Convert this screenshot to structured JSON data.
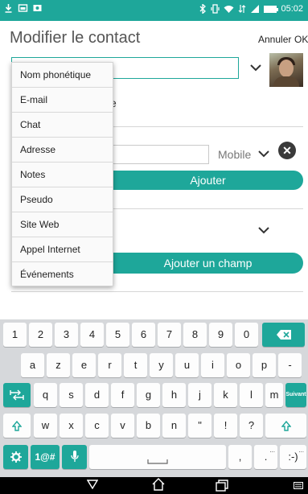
{
  "header": {
    "title": "Modifier le contact",
    "cancel_label": "Annuler",
    "ok_label": "OK"
  },
  "status_bar": {
    "time": "05:02"
  },
  "form": {
    "partial_label_tail": "e",
    "phone_type": "Mobile",
    "add_label": "Ajouter",
    "add_field_label": "Ajouter un champ"
  },
  "dropdown": {
    "items": [
      "Nom phonétique",
      "E-mail",
      "Chat",
      "Adresse",
      "Notes",
      "Pseudo",
      "Site Web",
      "Appel Internet",
      "Événements"
    ]
  },
  "keyboard": {
    "row_numbers": [
      "1",
      "2",
      "3",
      "4",
      "5",
      "6",
      "7",
      "8",
      "9",
      "0"
    ],
    "row_azerty": [
      "a",
      "z",
      "e",
      "r",
      "t",
      "y",
      "u",
      "i",
      "o",
      "p",
      "-"
    ],
    "row_middle": [
      "q",
      "s",
      "d",
      "f",
      "g",
      "h",
      "j",
      "k",
      "l",
      "m"
    ],
    "send_label": "Suivant",
    "row_bottom": [
      "w",
      "x",
      "c",
      "v",
      "b",
      "n",
      "\"",
      "!",
      "?"
    ],
    "symbols_label": "1@#",
    "comma": ",",
    "period": ".",
    "smiley": ":-)",
    "hint_ellipsis": "..."
  },
  "colors": {
    "accent": "#1ea79a",
    "keyboard_bg": "#d6d8db"
  }
}
